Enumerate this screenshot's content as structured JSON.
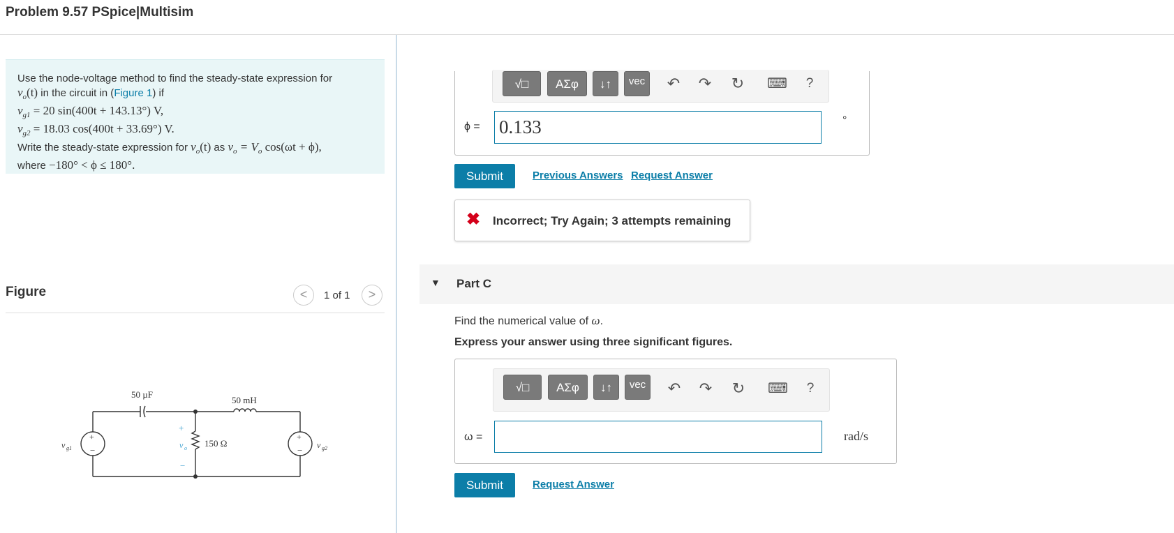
{
  "header": {
    "title": "Problem 9.57 PSpice|Multisim"
  },
  "problem": {
    "line1": "Use the node-voltage method to find the steady-state expression for",
    "line2_math": "v",
    "line2_sub": "o",
    "line2_math2": "(t)",
    "line2_text": " in the circuit in (",
    "line2_link": "Figure 1",
    "line2_end": ") if",
    "vg1_label": "v",
    "vg1_sub": "g1",
    "vg1_expr": " = 20 sin(400t + 143.13°) V,",
    "vg2_label": "v",
    "vg2_sub": "g2",
    "vg2_expr": " = 18.03 cos(400t + 33.69°) V.",
    "line5_text": "Write the steady-state expression for ",
    "line5_math": "v",
    "line5_sub": "o",
    "line5_math2": "(t)",
    "line5_as": " as ",
    "line5_expr": "v",
    "line5_expr_sub": "o",
    "line5_expr2": " = V",
    "line5_expr2_sub": "o",
    "line5_expr3": " cos(ωt + ϕ),",
    "line6_text": "where ",
    "line6_expr": "−180° < ϕ ≤ 180°."
  },
  "figure": {
    "title": "Figure",
    "pager_text": "1 of 1",
    "prev_glyph": "<",
    "next_glyph": ">",
    "labels": {
      "cap": "50 µF",
      "ind": "50 mH",
      "res": "150 Ω",
      "vg1": "v",
      "vg1_sub": "g1",
      "vg2": "v",
      "vg2_sub": "g2",
      "vo": "v",
      "vo_sub": "o",
      "plus": "+",
      "minus": "−"
    }
  },
  "toolbar": {
    "templates": "√□",
    "greek": "ΑΣφ",
    "arrows": "↓↑",
    "vec": "vec",
    "undo": "↶",
    "redo": "↷",
    "reset": "↻",
    "keyboard": "⌨",
    "help": "?"
  },
  "partB": {
    "label": "ϕ =",
    "value": "0.133",
    "unit": "°",
    "submit": "Submit",
    "prev_answers": "Previous Answers",
    "request": "Request Answer",
    "feedback_icon": "✖",
    "feedback": "Incorrect; Try Again; 3 attempts remaining"
  },
  "partC": {
    "caret": "▼",
    "title": "Part C",
    "question_pre": "Find the numerical value of ",
    "question_var": "ω",
    "question_post": ".",
    "instruction": "Express your answer using three significant figures.",
    "label": "ω =",
    "value": "",
    "unit": "rad/s",
    "submit": "Submit",
    "request": "Request Answer"
  },
  "colors": {
    "accent": "#0c7ea8",
    "error": "#d4001a",
    "problem_bg": "#e9f6f7"
  }
}
